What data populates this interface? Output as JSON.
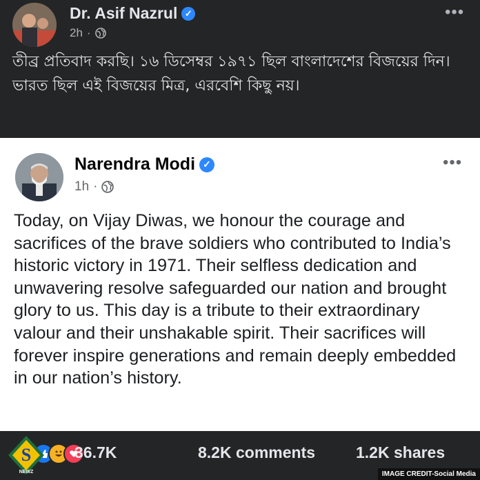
{
  "top_post": {
    "author": "Dr. Asif Nazrul",
    "time": "2h",
    "separator": "·",
    "text": "তীব্র প্রতিবাদ করছি। ১৬ ডিসেম্বর ১৯৭১ ছিল বাংলাদেশের বিজয়ের দিন। ভারত ছিল এই বিজয়ের মিত্র, এরবেশি কিছু নয়।"
  },
  "shared_post": {
    "author": "Narendra Modi",
    "time": "1h",
    "separator": "·",
    "text": "Today, on Vijay Diwas, we honour the courage and sacrifices of the brave soldiers who contributed to India’s historic victory in 1971. Their selfless dedication and unwavering resolve safeguarded our nation and brought glory to us. This day is a tribute to their extraordinary valour and their unshakable spirit. Their sacrifices will forever inspire generations and remain deeply embedded in our nation’s history."
  },
  "stats": {
    "reactions": "36.7K",
    "comments": "8.2K comments",
    "shares": "1.2K shares"
  },
  "more_label": "•••",
  "credit": "IMAGE CREDIT-Social Media",
  "logo_text": "NEWZ",
  "colors": {
    "verified": "#2d88ff",
    "like": "#1877f2",
    "haha": "#f7b125",
    "love": "#f33e58"
  }
}
